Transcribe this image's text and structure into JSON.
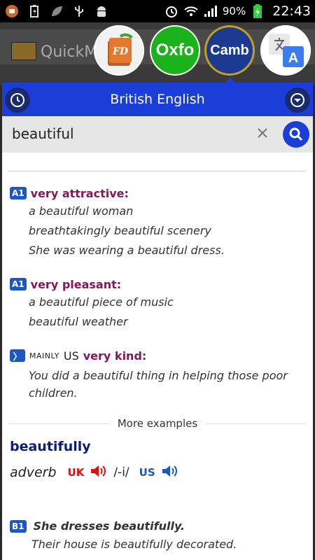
{
  "status_bar": {
    "battery": "90%",
    "time": "22:43"
  },
  "background_app": {
    "title": "QuickM"
  },
  "shortcut_icons": {
    "fd": "FD",
    "oxfo": "Oxfo",
    "camb": "Camb",
    "gt": "A"
  },
  "header": {
    "title": "British English"
  },
  "search": {
    "value": "beautiful"
  },
  "senses": [
    {
      "level": "A1",
      "definition": "very attractive:",
      "examples": [
        "a beautiful woman",
        "breathtakingly beautiful scenery",
        "She was wearing a beautiful dress."
      ]
    },
    {
      "level": "A1",
      "definition": "very pleasant:",
      "examples": [
        "a beautiful piece of music",
        "beautiful weather"
      ]
    },
    {
      "level": "〉",
      "label": "MAINLY",
      "region": "US",
      "definition": "very kind:",
      "examples": [
        "You did a beautiful thing in helping those poor children."
      ]
    }
  ],
  "more_examples": "More examples",
  "entry2": {
    "headword": "beautifully",
    "pos": "adverb",
    "uk": "UK",
    "pron": "/-i/",
    "us": "US",
    "sense": {
      "level": "B1",
      "examples": [
        "She dresses beautifully.",
        "Their house is beautifully decorated."
      ]
    }
  },
  "colors": {
    "header_blue": "#1c3ed8",
    "definition_purple": "#8a1558",
    "badge_blue": "#1d57c4",
    "headword_navy": "#0b1e7a",
    "uk_red": "#d11",
    "oxfo_green": "#1bb31b"
  }
}
